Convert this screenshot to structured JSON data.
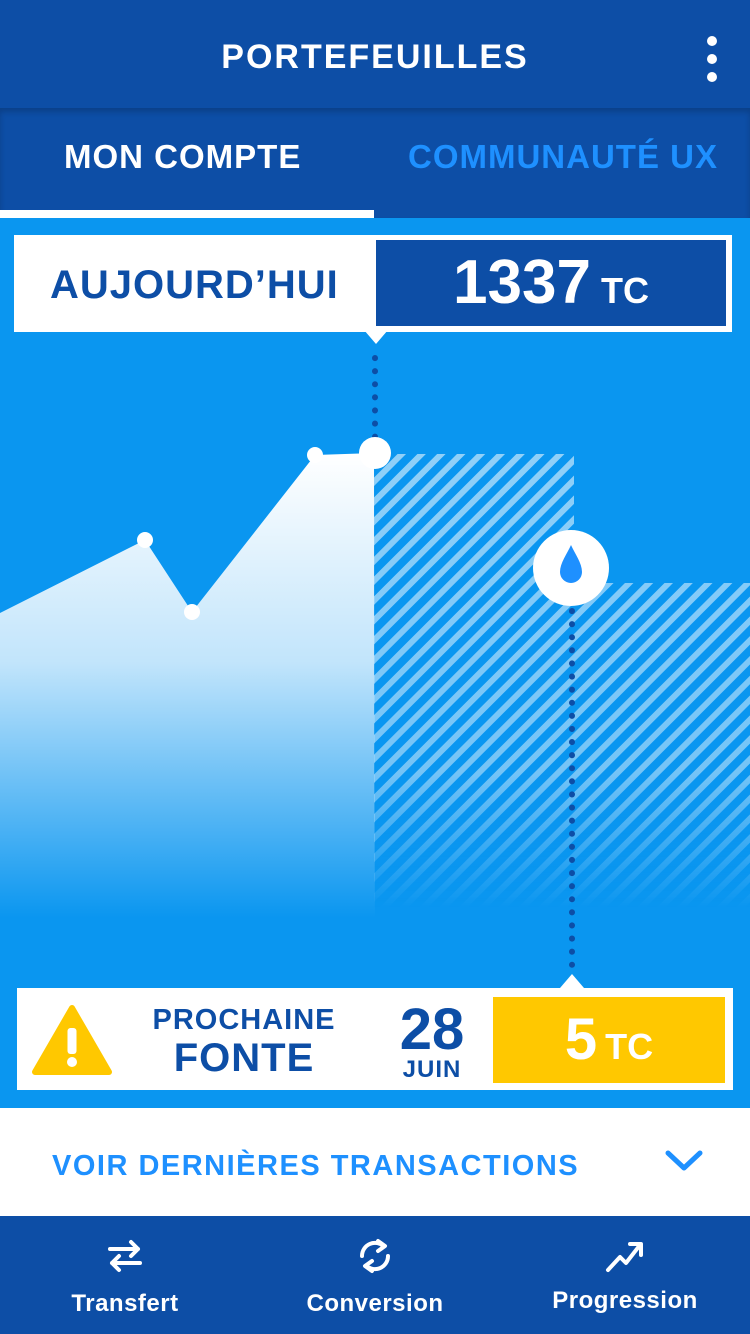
{
  "header": {
    "title": "PORTEFEUILLES",
    "menu_icon": "more-vertical-icon"
  },
  "tabs": [
    {
      "label": "MON COMPTE",
      "active": true
    },
    {
      "label": "COMMUNAUTÉ UX",
      "active": false
    }
  ],
  "today": {
    "label": "AUJOURD’HUI",
    "value": "1337",
    "unit": "TC"
  },
  "melt": {
    "icon": "warning-icon",
    "label_top": "PROCHAINE",
    "label_main": "FONTE",
    "day": "28",
    "month": "JUIN",
    "value": "5",
    "unit": "TC"
  },
  "transactions": {
    "label": "VOIR DERNIÈRES TRANSACTIONS",
    "icon": "chevron-down-icon"
  },
  "nav": [
    {
      "label": "Transfert",
      "icon": "transfer-arrows-icon"
    },
    {
      "label": "Conversion",
      "icon": "refresh-icon"
    },
    {
      "label": "Progression",
      "icon": "trend-up-icon"
    }
  ],
  "colors": {
    "primary_dark": "#0d4ea6",
    "primary": "#0a96f0",
    "accent_link": "#1e90ff",
    "warning": "#ffc800",
    "white": "#ffffff"
  }
}
